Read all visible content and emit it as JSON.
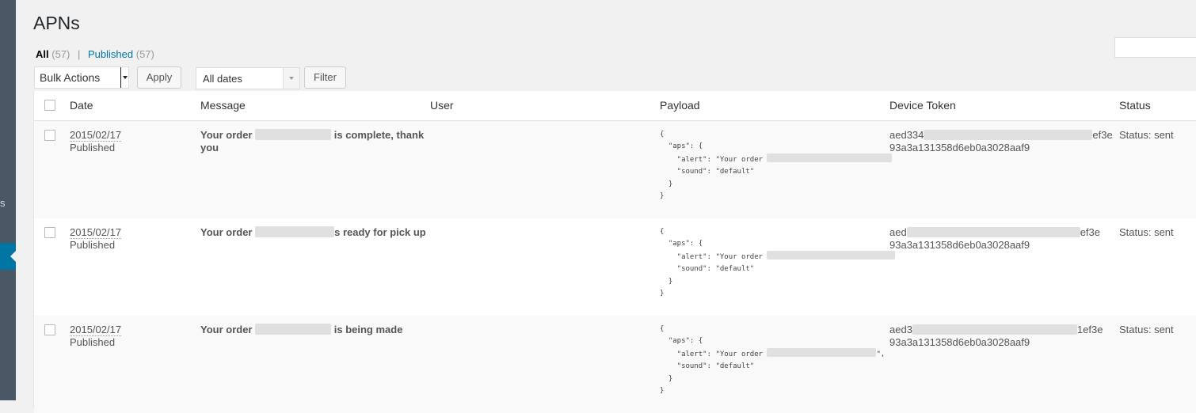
{
  "sidebar": {
    "fragment_text": "s"
  },
  "page": {
    "title": "APNs"
  },
  "views": {
    "all_label": "All",
    "all_count": "(57)",
    "separator": "|",
    "published_label": "Published",
    "published_count": "(57)"
  },
  "toolbar": {
    "bulk_actions": "Bulk Actions",
    "apply_label": "Apply",
    "dates_selected": "All dates",
    "filter_label": "Filter"
  },
  "table": {
    "columns": [
      "Date",
      "Message",
      "User",
      "Payload",
      "Device Token",
      "Status"
    ],
    "rows": [
      {
        "date": "2015/02/17",
        "state": "Published",
        "message_start": "Your order",
        "message_end": "is complete, thank you",
        "user": "",
        "payload_open": "{",
        "payload_aps": "  \"aps\": {",
        "payload_alert": "    \"alert\": \"Your order ",
        "payload_alert_tail": "",
        "payload_sound": "    \"sound\": \"default\"",
        "payload_close_inner": "  }",
        "payload_close": "}",
        "token_start": "aed334",
        "token_end": "ef3e",
        "token_line2": "93a3a131358d6eb0a3028aaf9",
        "status": "Status: sent"
      },
      {
        "date": "2015/02/17",
        "state": "Published",
        "message_start": "Your order",
        "message_end": "s ready for pick up",
        "user": "",
        "payload_open": "{",
        "payload_aps": "  \"aps\": {",
        "payload_alert": "    \"alert\": \"Your order ",
        "payload_alert_tail": "",
        "payload_sound": "    \"sound\": \"default\"",
        "payload_close_inner": "  }",
        "payload_close": "}",
        "token_start": "aed",
        "token_end": "ef3e",
        "token_line2": "93a3a131358d6eb0a3028aaf9",
        "status": "Status: sent"
      },
      {
        "date": "2015/02/17",
        "state": "Published",
        "message_start": "Your order",
        "message_end": "is being made",
        "user": "",
        "payload_open": "{",
        "payload_aps": "  \"aps\": {",
        "payload_alert": "    \"alert\": \"Your order ",
        "payload_alert_tail": "\",",
        "payload_sound": "    \"sound\": \"default\"",
        "payload_close_inner": "  }",
        "payload_close": "}",
        "token_start": "aed3",
        "token_end": "1ef3e",
        "token_line2": "93a3a131358d6eb0a3028aaf9",
        "status": "Status: sent"
      }
    ]
  }
}
